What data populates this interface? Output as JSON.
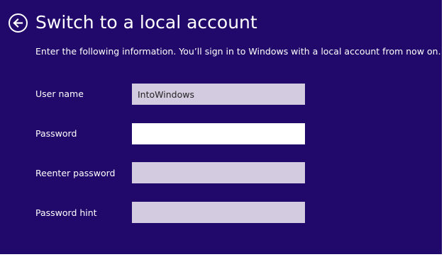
{
  "page": {
    "title": "Switch to a local account",
    "instruction": "Enter the following information. You’ll sign in to Windows with a local account from now on."
  },
  "colors": {
    "background": "#21096b",
    "text": "#ffffff",
    "input_inactive": "#d3cce1",
    "input_focused": "#ffffff"
  },
  "back_button": {
    "icon": "back-arrow-icon"
  },
  "form": {
    "username": {
      "label": "User name",
      "value": "IntoWindows"
    },
    "password": {
      "label": "Password",
      "value": "",
      "focused": true
    },
    "reenter_password": {
      "label": "Reenter password",
      "value": ""
    },
    "password_hint": {
      "label": "Password hint",
      "value": ""
    }
  }
}
